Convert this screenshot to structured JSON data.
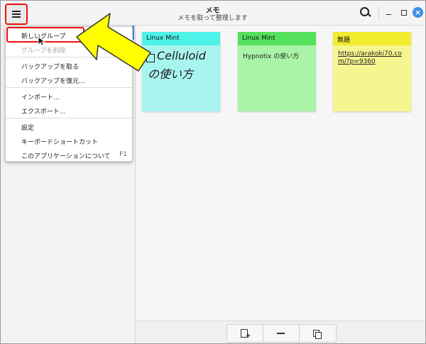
{
  "window": {
    "title": "メモ",
    "subtitle": "メモを取って整理します"
  },
  "icons": {
    "menu": "hamburger-menu-icon",
    "search": "search-icon",
    "minimize": "minimize-icon",
    "maximize": "maximize-icon",
    "close": "close-icon",
    "new_note": "new-note-icon",
    "remove": "remove-icon",
    "duplicate": "duplicate-icon"
  },
  "menu": {
    "new_group": "新しいグループ",
    "delete_group": "グループを削除",
    "backup": "バックアップを取る",
    "restore": "バックアップを復元...",
    "import": "インポート...",
    "export": "エクスポート...",
    "settings": "設定",
    "shortcuts": "キーボードショートカット",
    "about": "このアプリケーションについて",
    "about_shortcut": "F1"
  },
  "notes": [
    {
      "group": "Linux Mint",
      "text": "Celluloid",
      "text2": "の使い方",
      "checkbox": "unchecked",
      "header_color": "#4df2e8",
      "body_color": "#a8f5ef"
    },
    {
      "group": "Linux Mint",
      "text": "Hypnotix の使い方",
      "header_color": "#55e05c",
      "body_color": "#a9f4a6"
    },
    {
      "group": "無題",
      "text": "https://arakoki70.com/?p=9360",
      "header_color": "#f2ec2e",
      "body_color": "#f6f58f"
    }
  ],
  "colors": {
    "highlight": "#e11",
    "arrow": "#ffff00",
    "accent": "#3b8fe3"
  }
}
